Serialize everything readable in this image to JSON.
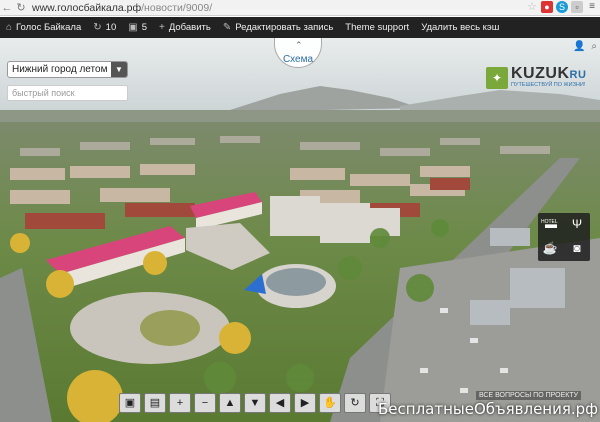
{
  "browser": {
    "url_host": "www.голосбайкала.рф",
    "url_path": "/новости/9009/"
  },
  "adminbar": {
    "site_name": "Голос Байкала",
    "updates_count": "10",
    "comments_count": "5",
    "add_label": "Добавить",
    "edit_label": "Редактировать запись",
    "theme_support_label": "Theme support",
    "clear_cache_label": "Удалить весь кэш"
  },
  "panorama": {
    "schema_label": "Схема",
    "city_select_value": "Нижний город летом",
    "quick_search_placeholder": "быстрый поиск",
    "logo_name": "KUZUK",
    "logo_suffix": "RU",
    "logo_tagline": "ПУТЕШЕСТВУЙ ПО ЖИЗНИ!",
    "hotel_label": "HOTEL",
    "questions_label": "ВСЕ ВОПРОСЫ ПО ПРОЕКТУ"
  },
  "watermark": "БесплатныеОбъявления.рф",
  "colors": {
    "sky": "#cfd6d8",
    "roof_pink": "#d8457a",
    "foliage": "#5f8a3a",
    "autumn": "#d9b335",
    "road": "#8d8f8c"
  }
}
